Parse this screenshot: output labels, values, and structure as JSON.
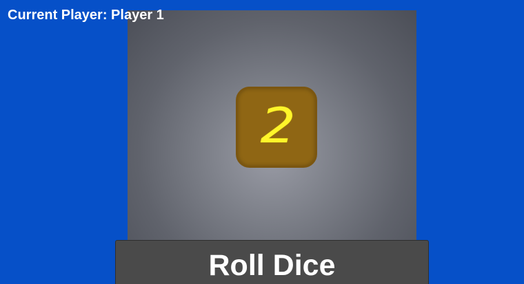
{
  "status": {
    "current_player_text": "Current Player: Player 1"
  },
  "die": {
    "value": "2",
    "face_color": "#8f6614",
    "pip_color": "#fff52a"
  },
  "controls": {
    "roll_button_label": "Roll Dice"
  },
  "colors": {
    "background": "#0650c8",
    "board": "#5a5d66",
    "button": "#4a4a4a"
  }
}
